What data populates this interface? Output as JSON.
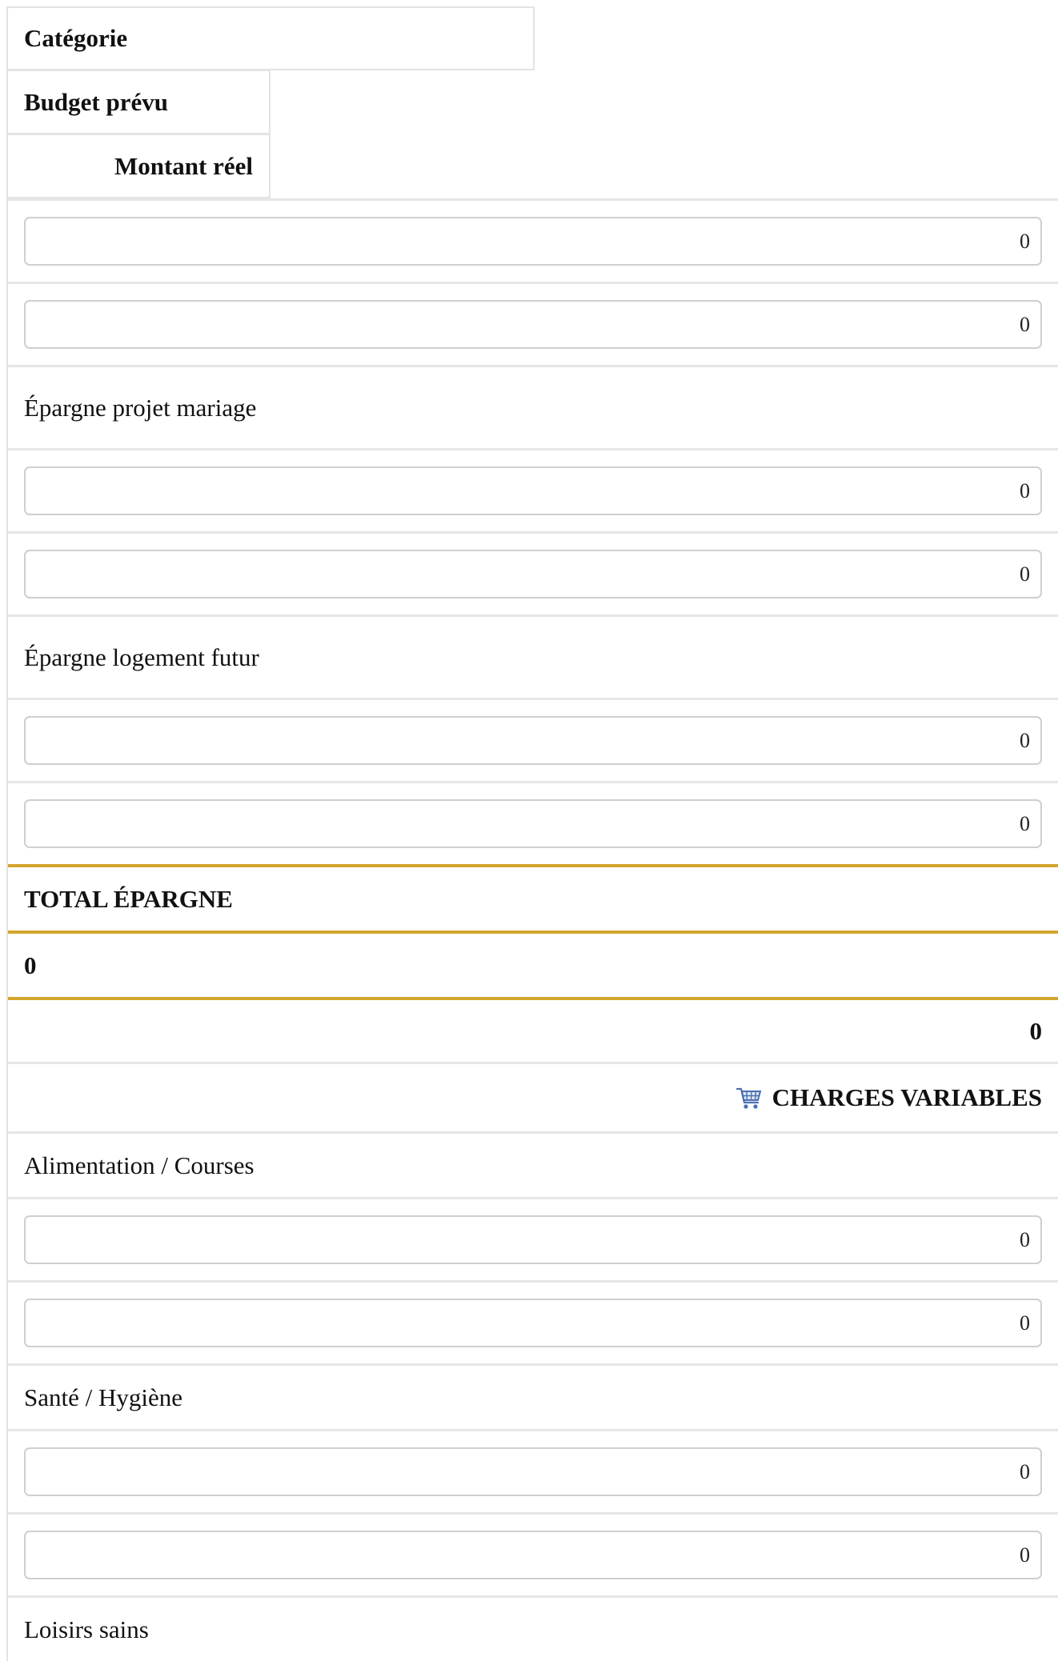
{
  "table_headers": {
    "category": "Catégorie",
    "budget": "Budget prévu",
    "actual": "Montant réel"
  },
  "epargne": {
    "top_rows": [
      {
        "budget": "0",
        "actual": "0"
      }
    ],
    "items": [
      {
        "label": "Épargne projet mariage",
        "budget": "0",
        "actual": "0"
      },
      {
        "label": "Épargne logement futur",
        "budget": "0",
        "actual": "0"
      }
    ],
    "total": {
      "label": "TOTAL ÉPARGNE",
      "budget": "0",
      "actual": "0"
    }
  },
  "charges_variables": {
    "title": "CHARGES VARIABLES",
    "icon": "shopping-cart-icon",
    "items": [
      {
        "label": "Alimentation / Courses",
        "budget": "0",
        "actual": "0"
      },
      {
        "label": "Santé / Hygiène",
        "budget": "0",
        "actual": "0"
      },
      {
        "label": "Loisirs sains"
      }
    ]
  },
  "colors": {
    "total_border": "#d4a52c",
    "row_border": "#e6e6e6",
    "input_border": "#cfcfcf"
  }
}
